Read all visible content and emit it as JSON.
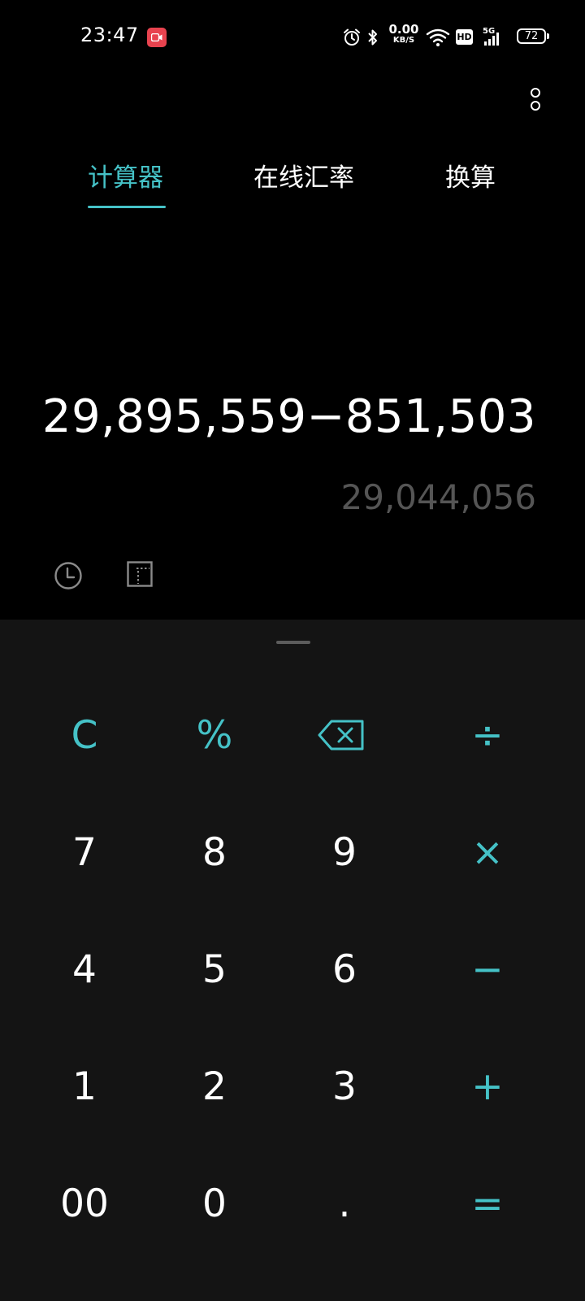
{
  "status_bar": {
    "time": "23:47",
    "net_speed_value": "0.00",
    "net_speed_unit": "KB/S",
    "hd_label": "HD",
    "signal_label": "5G",
    "battery": "72",
    "icons": [
      "screen-record-icon",
      "alarm-icon",
      "bluetooth-icon",
      "wifi-icon",
      "signal-icon",
      "battery-icon"
    ]
  },
  "tabs": [
    {
      "label": "计算器",
      "active": true
    },
    {
      "label": "在线汇率",
      "active": false
    },
    {
      "label": "换算",
      "active": false
    }
  ],
  "display": {
    "expression": "29,895,559−851,503",
    "result": "29,044,056"
  },
  "tools": [
    "history-icon",
    "scientific-mode-icon"
  ],
  "keypad": {
    "rows": [
      [
        "C",
        "%",
        "⌫",
        "÷"
      ],
      [
        "7",
        "8",
        "9",
        "×"
      ],
      [
        "4",
        "5",
        "6",
        "−"
      ],
      [
        "1",
        "2",
        "3",
        "+"
      ],
      [
        "00",
        "0",
        ".",
        "="
      ]
    ]
  },
  "colors": {
    "accent": "#45c2c7",
    "background": "#000000",
    "keypad_background": "#141414",
    "result_text": "#555555"
  }
}
